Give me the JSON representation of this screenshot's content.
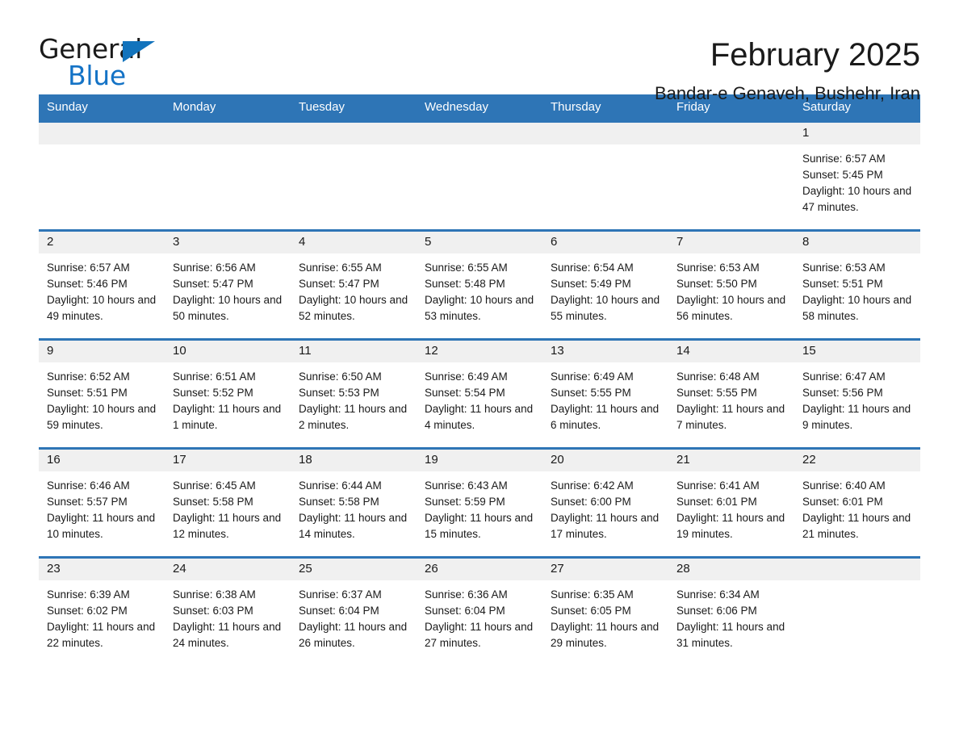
{
  "brand": {
    "name_part1": "General",
    "name_part2": "Blue",
    "accent_color": "#1273bc"
  },
  "header": {
    "title": "February 2025",
    "location": "Bandar-e Genaveh, Bushehr, Iran"
  },
  "theme": {
    "header_blue": "#2e75b6",
    "daynum_band": "#f0f0f0",
    "text": "#1a1a1a"
  },
  "weekday_headers": [
    "Sunday",
    "Monday",
    "Tuesday",
    "Wednesday",
    "Thursday",
    "Friday",
    "Saturday"
  ],
  "weeks": [
    [
      {
        "empty": true,
        "day": ""
      },
      {
        "empty": true,
        "day": ""
      },
      {
        "empty": true,
        "day": ""
      },
      {
        "empty": true,
        "day": ""
      },
      {
        "empty": true,
        "day": ""
      },
      {
        "empty": true,
        "day": ""
      },
      {
        "empty": false,
        "day": "1",
        "sunrise": "Sunrise: 6:57 AM",
        "sunset": "Sunset: 5:45 PM",
        "daylight": "Daylight: 10 hours and 47 minutes."
      }
    ],
    [
      {
        "empty": false,
        "day": "2",
        "sunrise": "Sunrise: 6:57 AM",
        "sunset": "Sunset: 5:46 PM",
        "daylight": "Daylight: 10 hours and 49 minutes."
      },
      {
        "empty": false,
        "day": "3",
        "sunrise": "Sunrise: 6:56 AM",
        "sunset": "Sunset: 5:47 PM",
        "daylight": "Daylight: 10 hours and 50 minutes."
      },
      {
        "empty": false,
        "day": "4",
        "sunrise": "Sunrise: 6:55 AM",
        "sunset": "Sunset: 5:47 PM",
        "daylight": "Daylight: 10 hours and 52 minutes."
      },
      {
        "empty": false,
        "day": "5",
        "sunrise": "Sunrise: 6:55 AM",
        "sunset": "Sunset: 5:48 PM",
        "daylight": "Daylight: 10 hours and 53 minutes."
      },
      {
        "empty": false,
        "day": "6",
        "sunrise": "Sunrise: 6:54 AM",
        "sunset": "Sunset: 5:49 PM",
        "daylight": "Daylight: 10 hours and 55 minutes."
      },
      {
        "empty": false,
        "day": "7",
        "sunrise": "Sunrise: 6:53 AM",
        "sunset": "Sunset: 5:50 PM",
        "daylight": "Daylight: 10 hours and 56 minutes."
      },
      {
        "empty": false,
        "day": "8",
        "sunrise": "Sunrise: 6:53 AM",
        "sunset": "Sunset: 5:51 PM",
        "daylight": "Daylight: 10 hours and 58 minutes."
      }
    ],
    [
      {
        "empty": false,
        "day": "9",
        "sunrise": "Sunrise: 6:52 AM",
        "sunset": "Sunset: 5:51 PM",
        "daylight": "Daylight: 10 hours and 59 minutes."
      },
      {
        "empty": false,
        "day": "10",
        "sunrise": "Sunrise: 6:51 AM",
        "sunset": "Sunset: 5:52 PM",
        "daylight": "Daylight: 11 hours and 1 minute."
      },
      {
        "empty": false,
        "day": "11",
        "sunrise": "Sunrise: 6:50 AM",
        "sunset": "Sunset: 5:53 PM",
        "daylight": "Daylight: 11 hours and 2 minutes."
      },
      {
        "empty": false,
        "day": "12",
        "sunrise": "Sunrise: 6:49 AM",
        "sunset": "Sunset: 5:54 PM",
        "daylight": "Daylight: 11 hours and 4 minutes."
      },
      {
        "empty": false,
        "day": "13",
        "sunrise": "Sunrise: 6:49 AM",
        "sunset": "Sunset: 5:55 PM",
        "daylight": "Daylight: 11 hours and 6 minutes."
      },
      {
        "empty": false,
        "day": "14",
        "sunrise": "Sunrise: 6:48 AM",
        "sunset": "Sunset: 5:55 PM",
        "daylight": "Daylight: 11 hours and 7 minutes."
      },
      {
        "empty": false,
        "day": "15",
        "sunrise": "Sunrise: 6:47 AM",
        "sunset": "Sunset: 5:56 PM",
        "daylight": "Daylight: 11 hours and 9 minutes."
      }
    ],
    [
      {
        "empty": false,
        "day": "16",
        "sunrise": "Sunrise: 6:46 AM",
        "sunset": "Sunset: 5:57 PM",
        "daylight": "Daylight: 11 hours and 10 minutes."
      },
      {
        "empty": false,
        "day": "17",
        "sunrise": "Sunrise: 6:45 AM",
        "sunset": "Sunset: 5:58 PM",
        "daylight": "Daylight: 11 hours and 12 minutes."
      },
      {
        "empty": false,
        "day": "18",
        "sunrise": "Sunrise: 6:44 AM",
        "sunset": "Sunset: 5:58 PM",
        "daylight": "Daylight: 11 hours and 14 minutes."
      },
      {
        "empty": false,
        "day": "19",
        "sunrise": "Sunrise: 6:43 AM",
        "sunset": "Sunset: 5:59 PM",
        "daylight": "Daylight: 11 hours and 15 minutes."
      },
      {
        "empty": false,
        "day": "20",
        "sunrise": "Sunrise: 6:42 AM",
        "sunset": "Sunset: 6:00 PM",
        "daylight": "Daylight: 11 hours and 17 minutes."
      },
      {
        "empty": false,
        "day": "21",
        "sunrise": "Sunrise: 6:41 AM",
        "sunset": "Sunset: 6:01 PM",
        "daylight": "Daylight: 11 hours and 19 minutes."
      },
      {
        "empty": false,
        "day": "22",
        "sunrise": "Sunrise: 6:40 AM",
        "sunset": "Sunset: 6:01 PM",
        "daylight": "Daylight: 11 hours and 21 minutes."
      }
    ],
    [
      {
        "empty": false,
        "day": "23",
        "sunrise": "Sunrise: 6:39 AM",
        "sunset": "Sunset: 6:02 PM",
        "daylight": "Daylight: 11 hours and 22 minutes."
      },
      {
        "empty": false,
        "day": "24",
        "sunrise": "Sunrise: 6:38 AM",
        "sunset": "Sunset: 6:03 PM",
        "daylight": "Daylight: 11 hours and 24 minutes."
      },
      {
        "empty": false,
        "day": "25",
        "sunrise": "Sunrise: 6:37 AM",
        "sunset": "Sunset: 6:04 PM",
        "daylight": "Daylight: 11 hours and 26 minutes."
      },
      {
        "empty": false,
        "day": "26",
        "sunrise": "Sunrise: 6:36 AM",
        "sunset": "Sunset: 6:04 PM",
        "daylight": "Daylight: 11 hours and 27 minutes."
      },
      {
        "empty": false,
        "day": "27",
        "sunrise": "Sunrise: 6:35 AM",
        "sunset": "Sunset: 6:05 PM",
        "daylight": "Daylight: 11 hours and 29 minutes."
      },
      {
        "empty": false,
        "day": "28",
        "sunrise": "Sunrise: 6:34 AM",
        "sunset": "Sunset: 6:06 PM",
        "daylight": "Daylight: 11 hours and 31 minutes."
      },
      {
        "empty": true,
        "day": ""
      }
    ]
  ]
}
